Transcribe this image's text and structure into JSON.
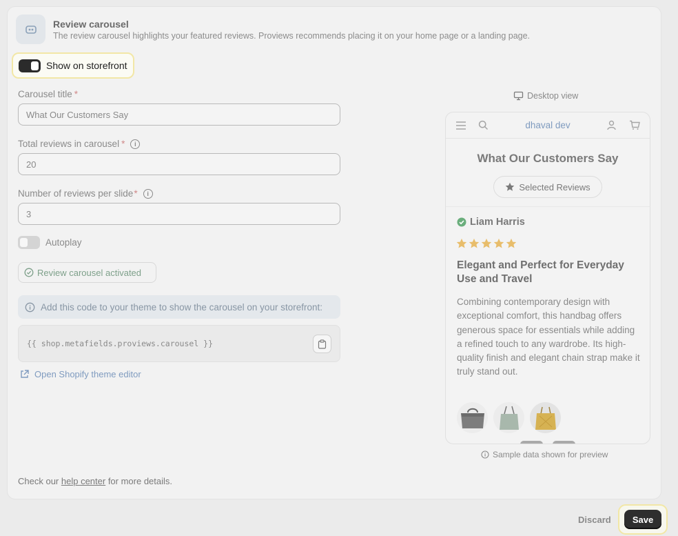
{
  "header": {
    "title": "Review carousel",
    "description": "The review carousel highlights your featured reviews. Proviews recommends placing it on your home page or a landing page."
  },
  "storefront_toggle": {
    "label": "Show on storefront",
    "enabled": true
  },
  "form": {
    "carousel_title": {
      "label": "Carousel title",
      "required_mark": "*",
      "value": "What Our Customers Say"
    },
    "total_reviews": {
      "label": "Total reviews in carousel",
      "required_mark": "*",
      "value": "20"
    },
    "reviews_per_slide": {
      "label": "Number of reviews per slide",
      "required_mark": "*",
      "value": "3"
    },
    "autoplay": {
      "label": "Autoplay",
      "enabled": false
    }
  },
  "status_badge": "Review carousel activated",
  "code_banner": "Add this code to your theme to show the carousel on your storefront:",
  "code_snippet": "{{ shop.metafields.proviews.carousel }}",
  "editor_link": "Open Shopify theme editor",
  "help": {
    "prefix": "Check our ",
    "link": "help center",
    "suffix": " for more details."
  },
  "preview": {
    "view_label": "Desktop view",
    "store_name": "dhaval dev",
    "heading": "What Our Customers Say",
    "chip": "Selected Reviews",
    "review": {
      "author": "Liam Harris",
      "rating": 5,
      "title": "Elegant and Perfect for Everyday Use and Travel",
      "body": "Combining contemporary design with exceptional comfort, this handbag offers generous space for essentials while adding a refined touch to any wardrobe. Its high-quality finish and elegant chain strap make it truly stand out."
    },
    "sample_note": "Sample data shown for preview"
  },
  "footer": {
    "discard": "Discard",
    "save": "Save"
  },
  "colors": {
    "accent_link": "#7f9bbf",
    "verified_green": "#6aae7c",
    "star_gold": "#e8bd6b",
    "save_bg": "#2e2e2e",
    "highlight_border": "#f2e7a6"
  }
}
